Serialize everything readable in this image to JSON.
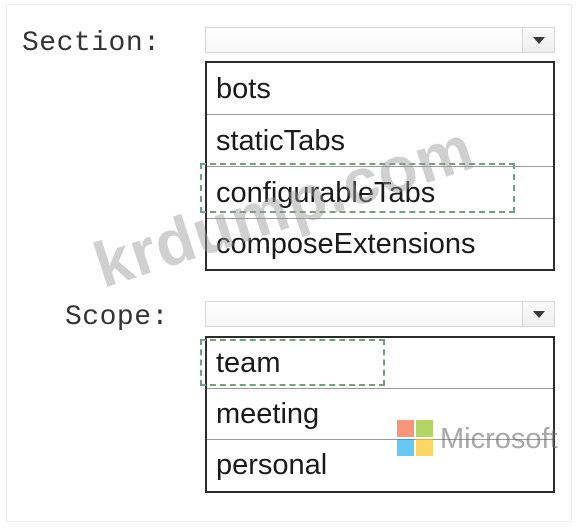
{
  "section": {
    "label": "Section:",
    "selected_value": "",
    "options": [
      "bots",
      "staticTabs",
      "configurableTabs",
      "composeExtensions"
    ]
  },
  "scope": {
    "label": "Scope:",
    "selected_value": "",
    "options": [
      "team",
      "meeting",
      "personal"
    ]
  },
  "watermarks": {
    "site": "krdump.com",
    "brand": "Microsoft"
  },
  "colors": {
    "dashed_highlight": "#6fa37b",
    "list_border": "#2c2c2c",
    "logo_red": "#f25022",
    "logo_green": "#7fba00",
    "logo_blue": "#00a4ef",
    "logo_yellow": "#ffb900"
  },
  "icons": {
    "dropdown": "chevron-down-icon",
    "brand_logo": "microsoft-logo"
  }
}
